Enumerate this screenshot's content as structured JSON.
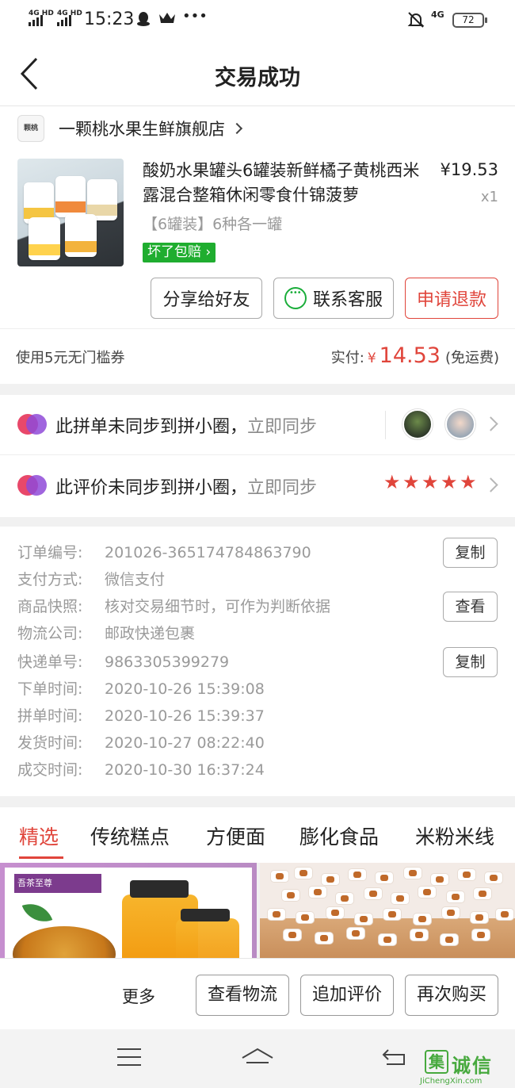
{
  "status_bar": {
    "network_1": "4G HD",
    "network_2": "4G HD",
    "time": "15:23",
    "network_right": "4G",
    "battery": "72",
    "icons": [
      "signal-icon",
      "qq-icon",
      "crown-icon",
      "more-dots-icon",
      "mute-icon",
      "battery-icon"
    ]
  },
  "nav": {
    "title": "交易成功",
    "back_icon": "back-arrow-icon"
  },
  "shop": {
    "logo_text": "颗桃",
    "name": "一颗桃水果生鲜旗舰店"
  },
  "product": {
    "title": "酸奶水果罐头6罐装新鲜橘子黄桃西米露混合整箱休闲零食什锦菠萝",
    "price": "¥19.53",
    "quantity": "x1",
    "spec": "【6罐装】6种各一罐",
    "badge": "坏了包赔"
  },
  "actions": {
    "share": "分享给好友",
    "contact": "联系客服",
    "refund": "申请退款"
  },
  "payment": {
    "coupon": "使用5元无门槛券",
    "paid_label": "实付:",
    "currency": "¥",
    "amount": "14.53",
    "shipping": "(免运费)"
  },
  "circle": {
    "order_text": "此拼单未同步到拼小圈，",
    "review_text": "此评价未同步到拼小圈，",
    "sync_link": "立即同步",
    "rating": 5,
    "accent": "#e0453b"
  },
  "info": {
    "rows": [
      {
        "label": "订单编号:",
        "value": "201026-365174784863790"
      },
      {
        "label": "支付方式:",
        "value": "微信支付"
      },
      {
        "label": "商品快照:",
        "value": "核对交易细节时，可作为判断依据"
      },
      {
        "label": "物流公司:",
        "value": "邮政快递包裹"
      },
      {
        "label": "快递单号:",
        "value": "9863305399279"
      },
      {
        "label": "下单时间:",
        "value": "2020-10-26 15:39:08"
      },
      {
        "label": "拼单时间:",
        "value": "2020-10-26 15:39:37"
      },
      {
        "label": "发货时间:",
        "value": "2020-10-27 08:22:40"
      },
      {
        "label": "成交时间:",
        "value": "2020-10-30 16:37:24"
      }
    ],
    "copy_label": "复制",
    "view_label": "查看"
  },
  "categories": {
    "tabs": [
      "精选",
      "传统糕点",
      "方便面",
      "膨化食品",
      "米粉米线"
    ],
    "active": 0
  },
  "promo": {
    "left_brand": "吾茶至尊 WuChaZhiZun"
  },
  "bottom_bar": {
    "more": "更多",
    "logistics": "查看物流",
    "add_review": "追加评价",
    "buy_again": "再次购买"
  },
  "watermark": {
    "mark": "集",
    "text": "诚信",
    "url": "JiChengXin.com"
  }
}
